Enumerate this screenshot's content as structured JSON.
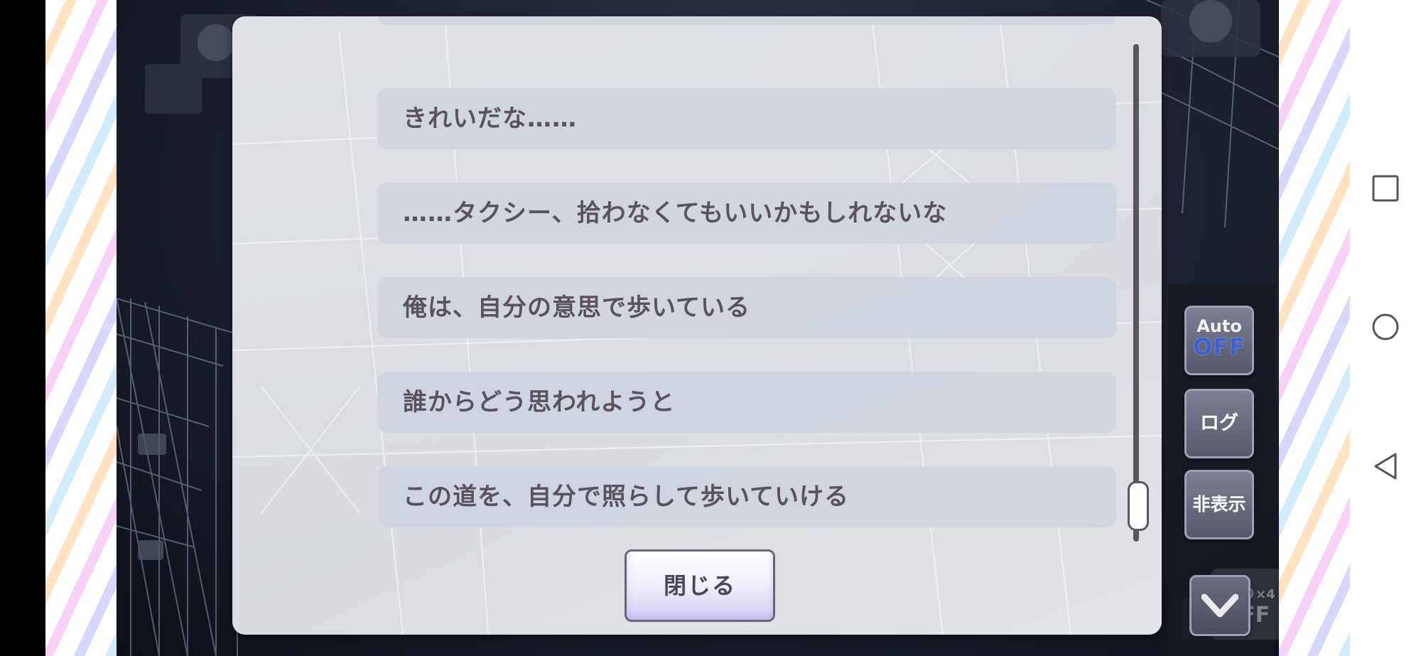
{
  "log_dialog": {
    "entries": [
      "",
      "きれいだな……",
      "……タクシー、拾わなくてもいいかもしれないな",
      "俺は、自分の意思で歩いている",
      "誰からどう思われようと",
      "この道を、自分で照らして歩いていける"
    ],
    "close_label": "閉じる"
  },
  "controls": {
    "auto_label": "Auto",
    "auto_state": "OFF",
    "log_label": "ログ",
    "hide_label": "非表示",
    "fast_forward_label": "早送り×4",
    "fast_forward_state": "OFF"
  },
  "colors": {
    "entry_bg": "#ced4dd",
    "entry_text": "#5b5260",
    "auto_off": "#3b63d6",
    "side_button": "#6a6d80"
  },
  "icons": {
    "nav": [
      "recent-apps-icon",
      "home-icon",
      "back-icon"
    ],
    "down": "chevron-down-icon"
  }
}
